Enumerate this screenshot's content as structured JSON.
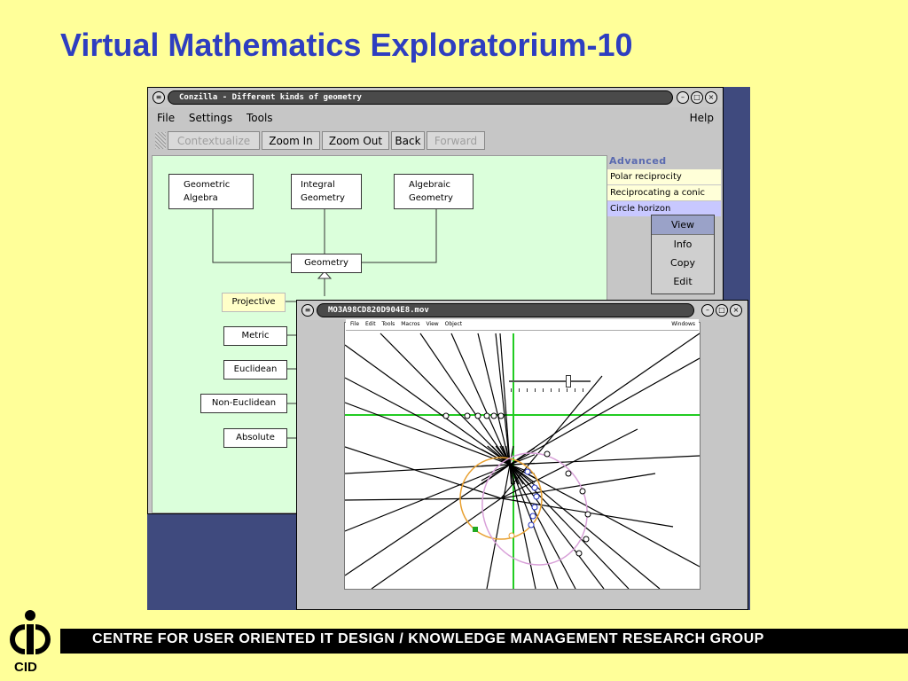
{
  "slide": {
    "title": "Virtual Mathematics Exploratorium-10",
    "footer": "CENTRE FOR USER ORIENTED IT DESIGN  /  KNOWLEDGE MANAGEMENT RESEARCH GROUP",
    "logo_text": "CID"
  },
  "conzilla": {
    "window_title": "Conzilla - Different kinds of geometry",
    "menus": [
      "File",
      "Settings",
      "Tools"
    ],
    "help_menu": "Help",
    "toolbar": {
      "contextualize": "Contextualize",
      "zoom_in": "Zoom In",
      "zoom_out": "Zoom Out",
      "back": "Back",
      "forward": "Forward"
    },
    "concepts": {
      "geometric_algebra": [
        "Geometric",
        "Algebra"
      ],
      "integral_geometry": [
        "Integral",
        "Geometry"
      ],
      "algebraic_geometry": [
        "Algebraic",
        "Geometry"
      ],
      "geometry": "Geometry",
      "projective": "Projective",
      "metric": "Metric",
      "euclidean": "Euclidean",
      "non_euclidean": "Non-Euclidean",
      "absolute": "Absolute"
    },
    "panel": {
      "header": "Advanced",
      "items": [
        "Polar reciprocity",
        "Reciprocating a conic",
        "Circle horizon"
      ]
    },
    "popup": [
      "View",
      "Info",
      "Copy",
      "Edit"
    ]
  },
  "movie": {
    "window_title": "MO3A98CD820D904E8.mov",
    "menus": [
      "File",
      "Edit",
      "Tools",
      "Macros",
      "View",
      "Object"
    ],
    "windows_menu": "Windows"
  },
  "colors": {
    "slide_bg": "#ffff99",
    "title": "#2e3ec0",
    "canvas_bg": "#dbffdb",
    "axis": "#22cc22",
    "circle": "#e8a030",
    "conic": "#d8a0d8"
  }
}
